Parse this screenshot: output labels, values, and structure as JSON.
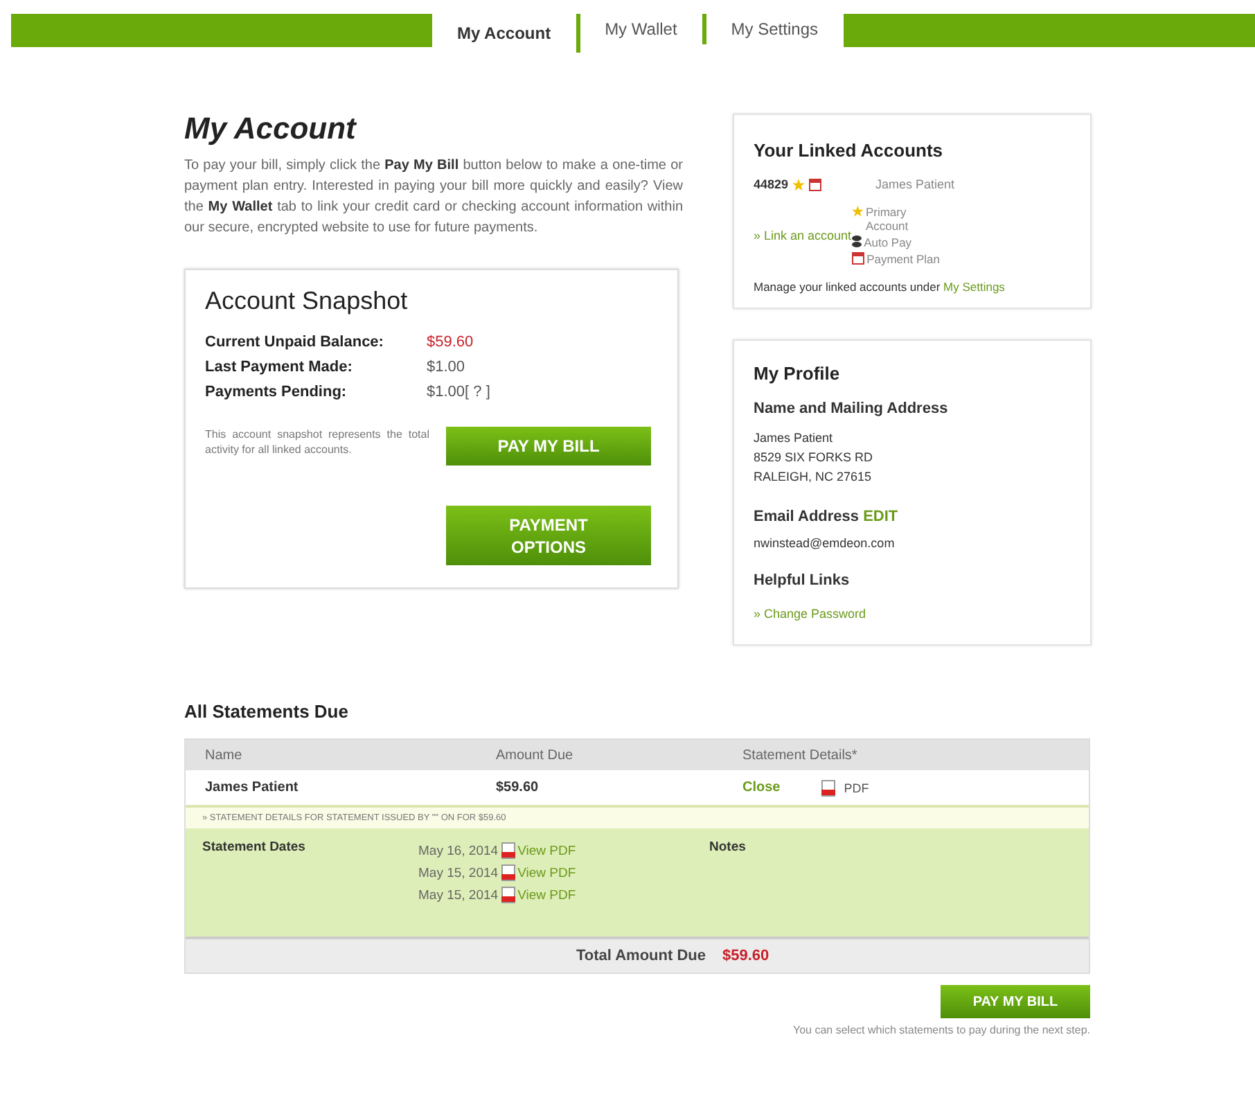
{
  "tabs": [
    {
      "label": "My Account",
      "selected": true
    },
    {
      "label": "My Wallet",
      "selected": false
    },
    {
      "label": "My Settings",
      "selected": false
    }
  ],
  "account": {
    "title": "My Account",
    "intro": "To pay your bill, simply click the **Pay My Bill** button below to make a one-time or payment plan entry. Interested in paying your bill more quickly and easily? View the **My Wallet** tab to link your credit card or checking account information within our secure, encrypted website to use for future payments."
  },
  "snapshot": {
    "title": "Account Snapshot",
    "rows": [
      {
        "label": "Current Unpaid Balance:",
        "value": "$59.60",
        "kind": "alert"
      },
      {
        "label": "Last Payment Made:",
        "value": "$1.00",
        "kind": "normal"
      },
      {
        "label": "Payments Pending:",
        "value": "$1.00[ ? ]",
        "kind": "normal"
      }
    ],
    "note": "This account snapshot represents the total activity for all linked accounts.",
    "pay_button": "PAY MY BILL",
    "options_button": "PAYMENT OPTIONS"
  },
  "linked_accounts": {
    "title": "Your Linked Accounts",
    "account_number": "44829",
    "account_name": "James Patient",
    "link": "» Link an account",
    "legend": [
      {
        "kind": "star",
        "label": "Primary Account"
      },
      {
        "kind": "autopay",
        "label": "Auto Pay"
      },
      {
        "kind": "plan",
        "label": "Payment Plan"
      }
    ],
    "manage_text": "Manage your linked accounts under",
    "manage_link": "My Settings"
  },
  "profile": {
    "title": "My Profile",
    "address_heading": "Name and Mailing Address",
    "address_lines": [
      "James Patient",
      "8529 SIX FORKS RD",
      "RALEIGH, NC 27615"
    ],
    "email_heading": "Email Address",
    "edit_link": "EDIT",
    "email": "nwinstead@emdeon.com",
    "links_heading": "Helpful Links",
    "link": "» Change Password"
  },
  "statements": {
    "title": "All Statements Due",
    "columns": [
      "Name",
      "Amount Due",
      "Statement Details*"
    ],
    "rows": [
      {
        "name": "James Patient",
        "amount": "$59.60",
        "action": "Close",
        "pdf": "PDF",
        "expanded": true
      }
    ],
    "detail": {
      "banner": "» STATEMENT DETAILS FOR STATEMENT ISSUED BY \"\" ON FOR $59.60",
      "dates_label": "Statement Dates",
      "dates": [
        {
          "date": "May 16, 2014",
          "link": "View PDF"
        },
        {
          "date": "May 15, 2014",
          "link": "View PDF"
        },
        {
          "date": "May 15, 2014",
          "link": "View PDF"
        }
      ],
      "notes_label": "Notes"
    },
    "total_label": "Total Amount Due",
    "total_value": "$59.60",
    "pay_button": "PAY MY BILL",
    "footnote": "You can select which statements to pay during the next step."
  }
}
